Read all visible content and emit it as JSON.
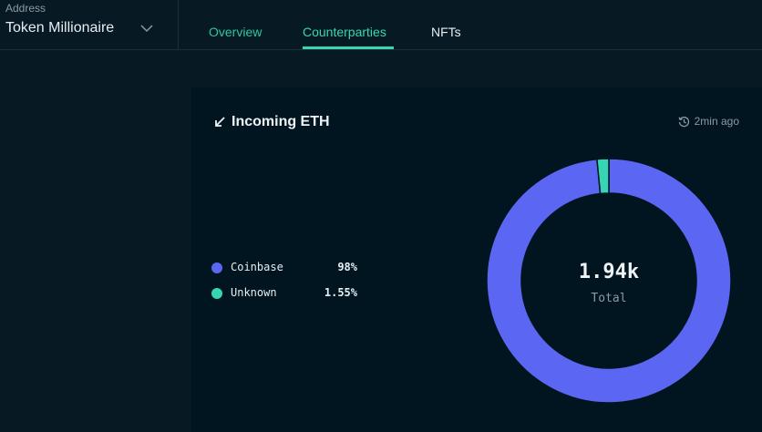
{
  "header": {
    "address_label": "Address",
    "address_value": "Token Millionaire",
    "tabs": [
      {
        "label": "Overview"
      },
      {
        "label": "Counterparties"
      },
      {
        "label": "NFTs"
      }
    ],
    "active_tab": "Counterparties"
  },
  "card": {
    "title": "Incoming ETH",
    "updated": "2min ago",
    "legend": [
      {
        "name": "Coinbase",
        "percent": "98%",
        "color": "#5b67f2"
      },
      {
        "name": "Unknown",
        "percent": "1.55%",
        "color": "#37d6b3"
      }
    ],
    "total_value": "1.94k",
    "total_label": "Total"
  },
  "chart_data": {
    "type": "pie",
    "categories": [
      "Coinbase",
      "Unknown"
    ],
    "values": [
      98,
      1.55
    ],
    "colors": [
      "#5b67f2",
      "#37d6b3"
    ],
    "title": "Incoming ETH",
    "legend": "left"
  }
}
